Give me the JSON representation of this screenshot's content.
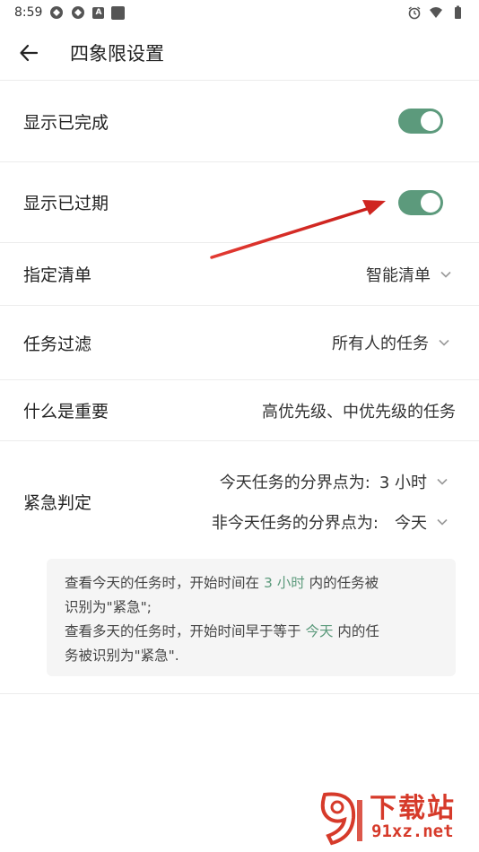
{
  "status_bar": {
    "time": "8:59",
    "left_icons": [
      "app-icon",
      "app-icon",
      "a-icon",
      "square-icon"
    ],
    "right_icons": [
      "alarm-icon",
      "wifi-icon",
      "battery-icon"
    ]
  },
  "app_bar": {
    "title": "四象限设置",
    "back_icon": "back-arrow-icon"
  },
  "settings": {
    "show_completed": {
      "label": "显示已完成",
      "enabled": true
    },
    "show_overdue": {
      "label": "显示已过期",
      "enabled": true
    },
    "specified_list": {
      "label": "指定清单",
      "value": "智能清单"
    },
    "task_filter": {
      "label": "任务过滤",
      "value": "所有人的任务"
    },
    "what_is_important": {
      "label": "什么是重要",
      "value": "高优先级、中优先级的任务"
    },
    "urgency": {
      "label": "紧急判定",
      "today_prefix": "今天任务的分界点为:",
      "today_value": "3 小时",
      "other_prefix": "非今天任务的分界点为:",
      "other_value": "今天",
      "note": {
        "l1_a": "查看今天的任务时，开始时间在 ",
        "l1_hl": "3 小时",
        "l1_b": " 内的任务被",
        "l2": "识别为\"紧急\";",
        "l3_a": "查看多天的任务时，开始时间早于等于 ",
        "l3_hl": "今天",
        "l3_b": " 内的任",
        "l4": "务被识别为\"紧急\"."
      }
    }
  },
  "watermark": {
    "title": "下载站",
    "url": "91xz.net"
  },
  "colors": {
    "accent": "#5c9a7c",
    "annotation_arrow": "#d9231f",
    "watermark": "#d63a2a"
  }
}
